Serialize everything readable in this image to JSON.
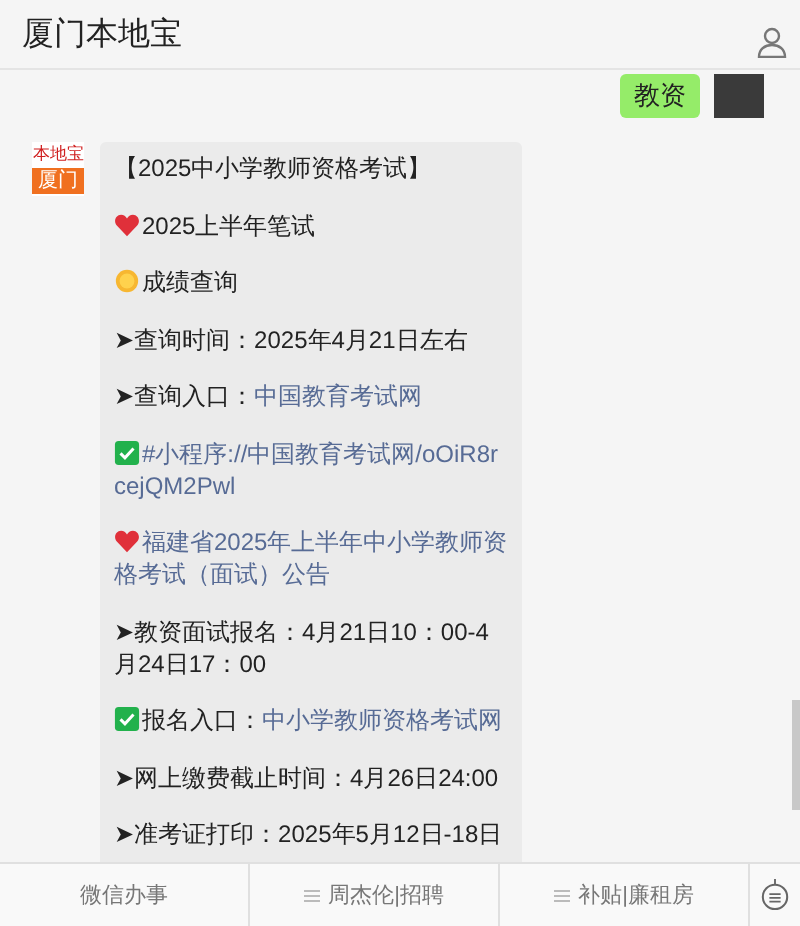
{
  "window": {
    "title": "厦门本地宝"
  },
  "messages": [
    {
      "kind": "outgoing",
      "text": "教资"
    },
    {
      "kind": "incoming",
      "logo": {
        "top": "本地宝",
        "bottom": "厦门"
      },
      "paragraphs": [
        {
          "kind": "plain",
          "segments": [
            {
              "kind": "text",
              "text": "【2025中小学教师资格考试】"
            }
          ]
        },
        {
          "kind": "heart",
          "segments": [
            {
              "kind": "text",
              "text": "2025上半年笔试"
            }
          ]
        },
        {
          "kind": "sun",
          "segments": [
            {
              "kind": "text",
              "text": "成绩查询"
            }
          ]
        },
        {
          "kind": "plain",
          "segments": [
            {
              "kind": "text",
              "text": "➤查询时间：2025年4月21日左右"
            }
          ]
        },
        {
          "kind": "plain",
          "segments": [
            {
              "kind": "text",
              "text": "➤查询入口："
            },
            {
              "kind": "link",
              "text": "中国教育考试网"
            }
          ]
        },
        {
          "kind": "check",
          "segments": [
            {
              "kind": "link",
              "text": "#小程序://中国教育考试网/oOiR8rcejQM2Pwl"
            }
          ]
        },
        {
          "kind": "heart",
          "segments": [
            {
              "kind": "link",
              "text": "福建省2025年上半年中小学教师资格考试（面试）公告"
            }
          ]
        },
        {
          "kind": "plain",
          "segments": [
            {
              "kind": "text",
              "text": "➤教资面试报名：4月21日10：00-4月24日17：00"
            }
          ]
        },
        {
          "kind": "check",
          "segments": [
            {
              "kind": "text",
              "text": "报名入口："
            },
            {
              "kind": "link",
              "text": "中小学教师资格考试网"
            }
          ]
        },
        {
          "kind": "plain",
          "segments": [
            {
              "kind": "text",
              "text": "➤网上缴费截止时间：4月26日24:00"
            }
          ]
        },
        {
          "kind": "plain",
          "segments": [
            {
              "kind": "text",
              "text": "➤准考证打印：2025年5月12日-18日"
            }
          ]
        }
      ]
    }
  ],
  "menu": [
    {
      "kind": "plain",
      "label": "微信办事"
    },
    {
      "kind": "submenu",
      "label": "周杰伦|招聘"
    },
    {
      "kind": "submenu",
      "label": "补贴|廉租房"
    }
  ]
}
